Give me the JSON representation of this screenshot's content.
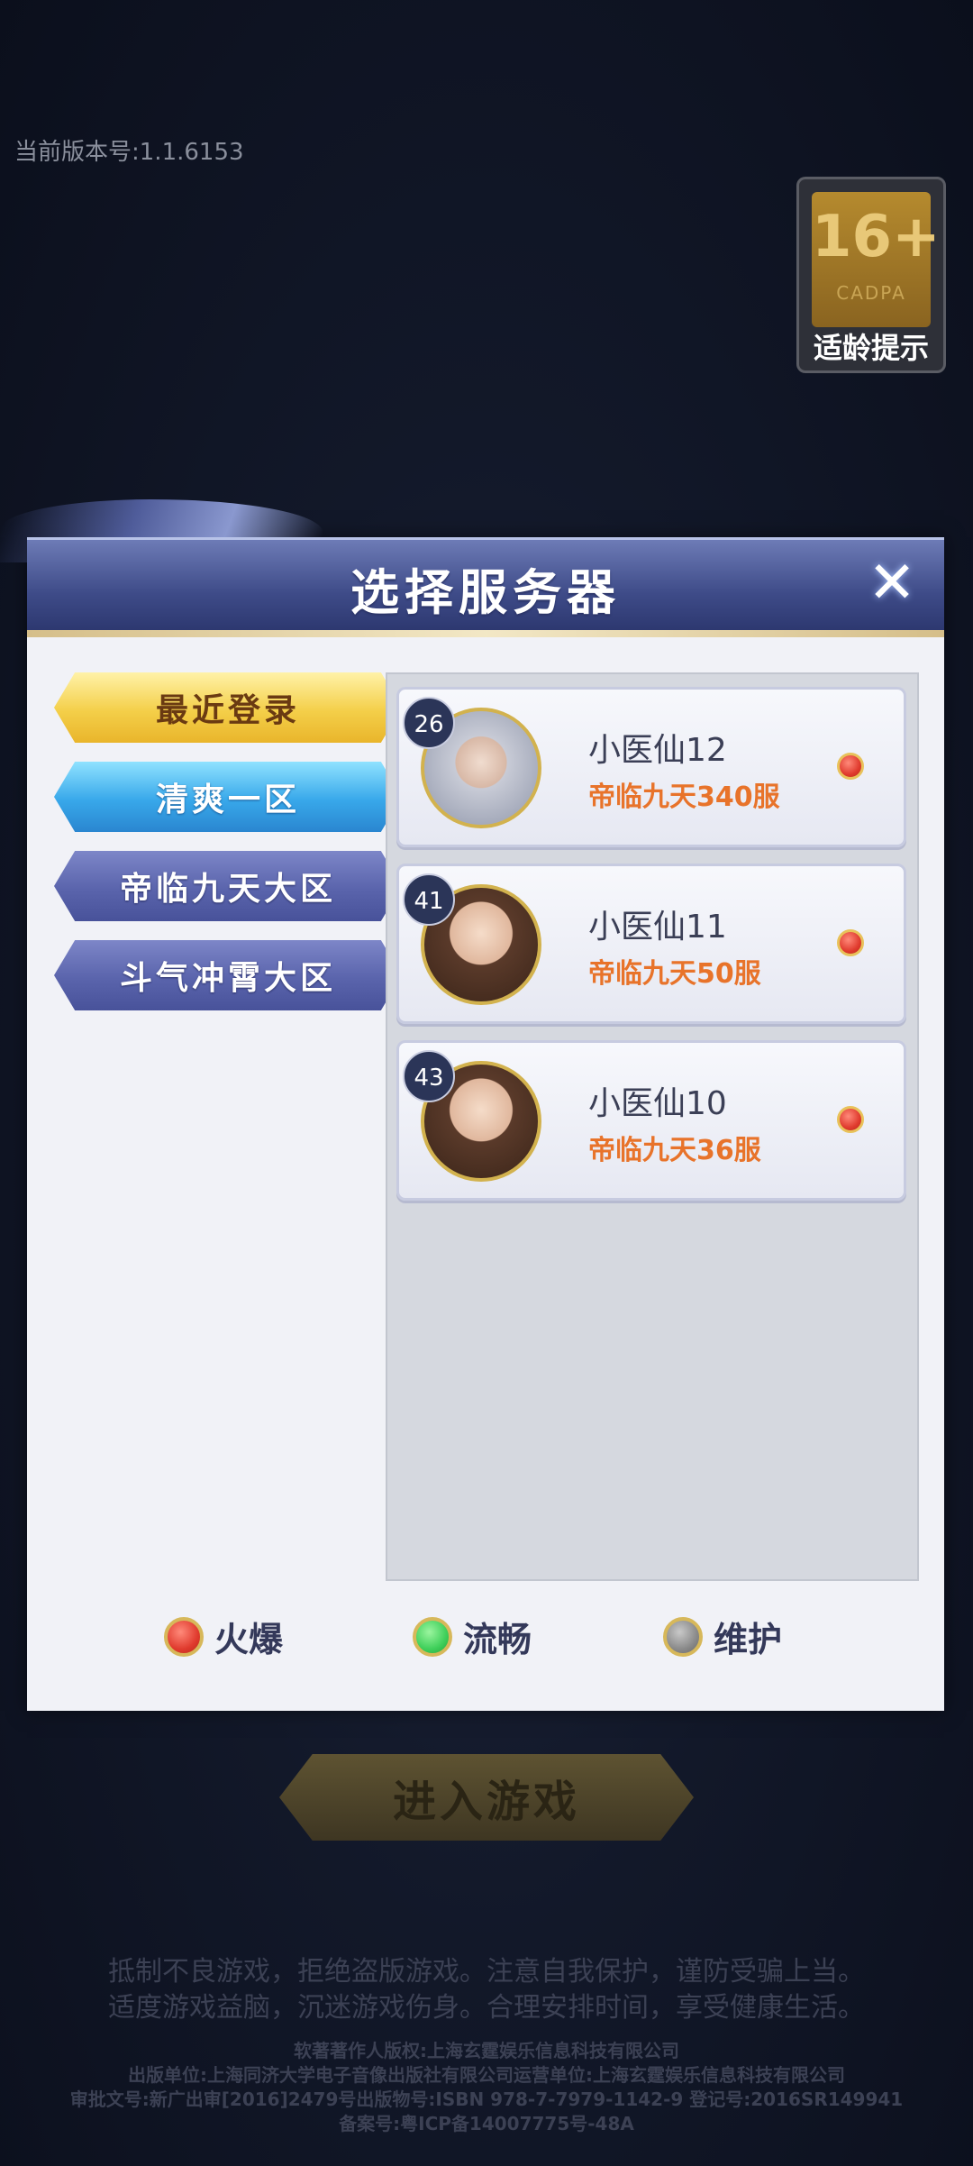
{
  "version_text": "当前版本号:1.1.6153",
  "age_badge": {
    "rating": "16+",
    "org": "CADPA",
    "tip": "适龄提示"
  },
  "modal": {
    "title": "选择服务器",
    "close_icon": "close-icon",
    "tabs": [
      {
        "label": "最近登录",
        "style": "gold"
      },
      {
        "label": "清爽一区",
        "style": "active"
      },
      {
        "label": "帝临九天大区",
        "style": "normal"
      },
      {
        "label": "斗气冲霄大区",
        "style": "normal"
      }
    ],
    "servers": [
      {
        "level": "26",
        "name": "小医仙12",
        "server": "帝临九天340服",
        "status": "hot"
      },
      {
        "level": "41",
        "name": "小医仙11",
        "server": "帝临九天50服",
        "status": "hot"
      },
      {
        "level": "43",
        "name": "小医仙10",
        "server": "帝临九天36服",
        "status": "hot"
      }
    ],
    "legend": [
      {
        "label": "火爆",
        "color": "#e03b2e"
      },
      {
        "label": "流畅",
        "color": "#3fcf5a"
      },
      {
        "label": "维护",
        "color": "#8a8a8a"
      }
    ]
  },
  "enter_button": "进入游戏",
  "notice": [
    "抵制不良游戏，拒绝盗版游戏。注意自我保护，谨防受骗上当。",
    "适度游戏益脑，沉迷游戏伤身。合理安排时间，享受健康生活。"
  ],
  "credits": [
    "软著著作人版权:上海玄霆娱乐信息科技有限公司",
    "出版单位:上海同济大学电子音像出版社有限公司运营单位:上海玄霆娱乐信息科技有限公司",
    "审批文号:新广出审[2016]2479号出版物号:ISBN 978-7-7979-1142-9 登记号:2016SR149941",
    "备案号:粤ICP备14007775号-48A"
  ]
}
